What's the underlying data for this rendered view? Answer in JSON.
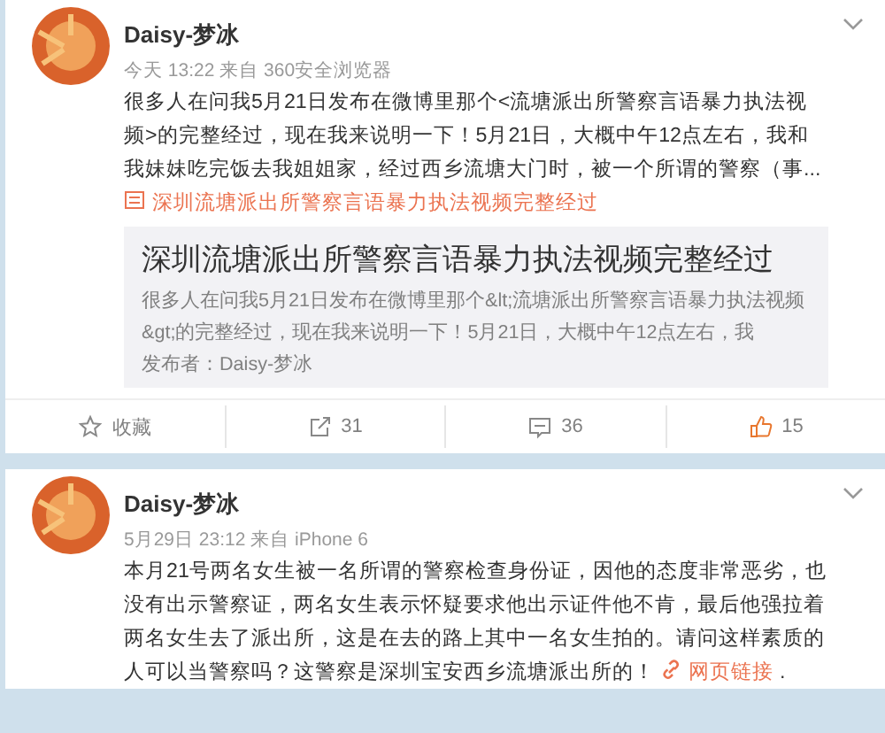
{
  "posts": [
    {
      "author": "Daisy-梦冰",
      "meta": "今天 13:22 来自 360安全浏览器",
      "text": "很多人在问我5月21日发布在微博里那个<流塘派出所警察言语暴力执法视频>的完整经过，现在我来说明一下！5月21日，大概中午12点左右，我和我妹妹吃完饭去我姐姐家，经过西乡流塘大门时，被一个所谓的警察（事...",
      "link": {
        "kind": "article",
        "label": "深圳流塘派出所警察言语暴力执法视频完整经过"
      },
      "card": {
        "title": "深圳流塘派出所警察言语暴力执法视频完整经过",
        "summary": "很多人在问我5月21日发布在微博里那个&lt;流塘派出所警察言语暴力执法视频&gt;的完整经过，现在我来说明一下！5月21日，大概中午12点左右，我",
        "publisher": "发布者：Daisy-梦冰"
      },
      "actions": [
        {
          "kind": "favorite",
          "label": "收藏"
        },
        {
          "kind": "repost",
          "label": "31"
        },
        {
          "kind": "comment",
          "label": "36"
        },
        {
          "kind": "like",
          "label": "15"
        }
      ]
    },
    {
      "author": "Daisy-梦冰",
      "meta": "5月29日 23:12 来自 iPhone 6",
      "text": "本月21号两名女生被一名所谓的警察检查身份证，因他的态度非常恶劣，也没有出示警察证，两名女生表示怀疑要求他出示证件他不肯，最后他强拉着两名女生去了派出所，这是在去的路上其中一名女生拍的。请问这样素质的人可以当警察吗？这警察是深圳宝安西乡流塘派出所的！",
      "link": {
        "kind": "web",
        "label": "网页链接"
      },
      "tail": "."
    }
  ]
}
